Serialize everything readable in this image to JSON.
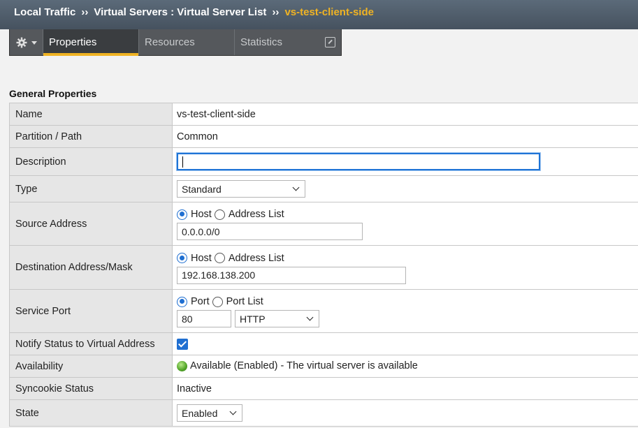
{
  "breadcrumb": {
    "section": "Local Traffic",
    "separator1": "››",
    "list": "Virtual Servers : Virtual Server List",
    "separator2": "››",
    "current": "vs-test-client-side"
  },
  "tabs": {
    "properties": "Properties",
    "resources": "Resources",
    "statistics": "Statistics",
    "active": "Properties"
  },
  "section_title": "General Properties",
  "fields": {
    "name": {
      "label": "Name",
      "value": "vs-test-client-side"
    },
    "partition": {
      "label": "Partition / Path",
      "value": "Common"
    },
    "description": {
      "label": "Description",
      "value": ""
    },
    "type": {
      "label": "Type",
      "value": "Standard"
    },
    "source_address": {
      "label": "Source Address",
      "option_host": "Host",
      "option_list": "Address List",
      "selected": "Host",
      "value": "0.0.0.0/0"
    },
    "destination": {
      "label": "Destination Address/Mask",
      "option_host": "Host",
      "option_list": "Address List",
      "selected": "Host",
      "value": "192.168.138.200"
    },
    "service_port": {
      "label": "Service Port",
      "option_port": "Port",
      "option_list": "Port List",
      "selected": "Port",
      "port": "80",
      "protocol": "HTTP"
    },
    "notify_status": {
      "label": "Notify Status to Virtual Address",
      "checked": true
    },
    "availability": {
      "label": "Availability",
      "value": "Available (Enabled) - The virtual server is available",
      "status_color": "#4fa326"
    },
    "syncookie": {
      "label": "Syncookie Status",
      "value": "Inactive"
    },
    "state": {
      "label": "State",
      "value": "Enabled"
    }
  },
  "colors": {
    "accent": "#f0b323",
    "focus": "#1f74d6",
    "header": "#4f5c69"
  }
}
